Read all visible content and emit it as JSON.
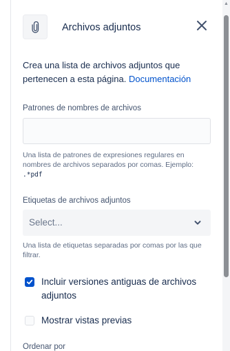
{
  "panel": {
    "title": "Archivos adjuntos",
    "description_text": "Crea una lista de archivos adjuntos que pertenecen a esta página. ",
    "description_link": "Documentación"
  },
  "icons": {
    "header": "paperclip-icon",
    "close": "close-icon",
    "dropdown": "chevron-down-icon",
    "checkbox": "check-icon"
  },
  "colors": {
    "accent": "#0052cc",
    "text": "#172b4d",
    "muted": "#5e6c84"
  },
  "fields": {
    "patterns": {
      "label": "Patrones de nombres de archivos",
      "value": "",
      "placeholder": "",
      "help_text": "Una lista de patrones de expresiones regulares en nombres de archivos separados por comas. Ejemplo: ",
      "help_code": ".*pdf"
    },
    "labels": {
      "label": "Etiquetas de archivos adjuntos",
      "placeholder": "Select...",
      "help_text": "Una lista de etiquetas separadas por comas por las que filtrar."
    },
    "old_versions": {
      "label": "Incluir versiones antiguas de archivos adjuntos",
      "checked": true
    },
    "previews": {
      "label": "Mostrar vistas previas",
      "checked": false
    },
    "sort": {
      "label": "Ordenar por"
    }
  }
}
